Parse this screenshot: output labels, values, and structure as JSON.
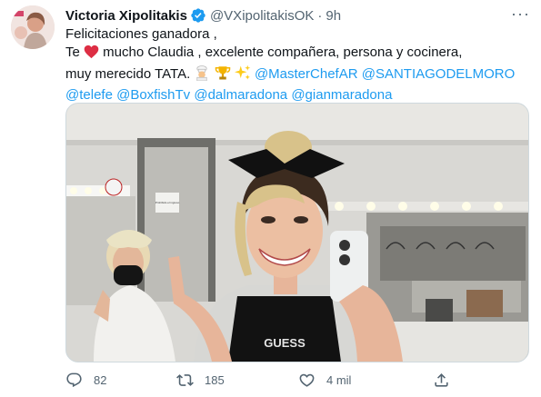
{
  "tweet": {
    "author_name": "Victoria Xipolitakis",
    "author_handle": "@VXipolitakisOK",
    "separator": "·",
    "timestamp": "9h",
    "more_label": "···",
    "lines": {
      "l1": "Felicitaciones ganadora ,",
      "l2_pre": "Te",
      "l2_post": " mucho Claudia , excelente compañera, persona y cocinera,",
      "l3_pre": "muy merecido TATA. "
    },
    "mentions": [
      "@MasterChefAR",
      "@SANTIAGODELMORO",
      "@telefe",
      "@BoxfishTv",
      "@dalmaradona",
      "@gianmaradona"
    ],
    "emojis": [
      "red-heart",
      "cook",
      "trophy",
      "sparkles"
    ],
    "image_text": {
      "shirt": "GUESS",
      "sign": "Prohibido el ingreso"
    },
    "actions": {
      "replies": "82",
      "retweets": "185",
      "likes": "4 mil"
    }
  },
  "colors": {
    "link": "#1d9bf0",
    "muted": "#536471",
    "verified": "#1d9bf0",
    "heart": "#e0245e"
  }
}
